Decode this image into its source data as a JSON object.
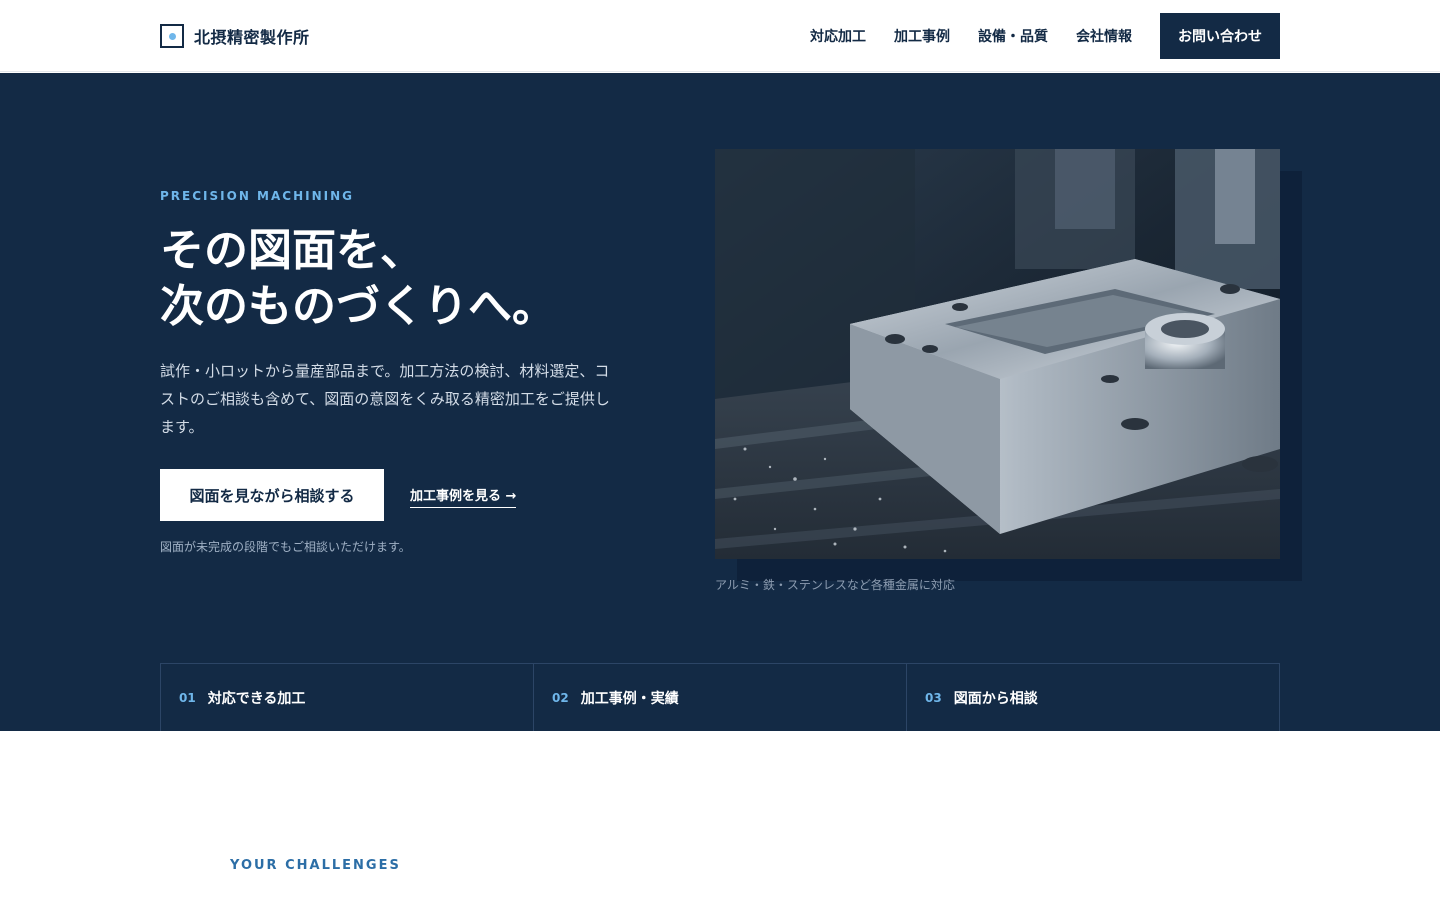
{
  "header": {
    "brand": "北摂精密製作所",
    "nav": [
      "対応加工",
      "加工事例",
      "設備・品質",
      "会社情報"
    ],
    "cta": "お問い合わせ"
  },
  "hero": {
    "eyebrow": "PRECISION MACHINING",
    "headline": [
      "その図面を、",
      "次のものづくりへ。"
    ],
    "lead": "試作・小ロットから量産部品まで。加工方法の検討、材料選定、コストのご相談も含めて、図面の意図をくみ取る精密加工をご提供します。",
    "primary_button": "図面を見ながら相談する",
    "secondary_link": "加工事例を見る →",
    "note": "図面が未完成の段階でもご相談いただけます。",
    "image_caption": "アルミ・鉄・ステンレスなど各種金属に対応"
  },
  "cards": [
    {
      "num": "01",
      "label": "対応できる加工"
    },
    {
      "num": "02",
      "label": "加工事例・実績"
    },
    {
      "num": "03",
      "label": "図面から相談"
    }
  ],
  "next_section": {
    "eyebrow": "YOUR CHALLENGES"
  },
  "colors": {
    "navy": "#132a45",
    "accent": "#6fb6ea",
    "white": "#ffffff"
  },
  "icons": {
    "logo": "square-dot-logo-icon",
    "arrow": "arrow-right-icon"
  }
}
